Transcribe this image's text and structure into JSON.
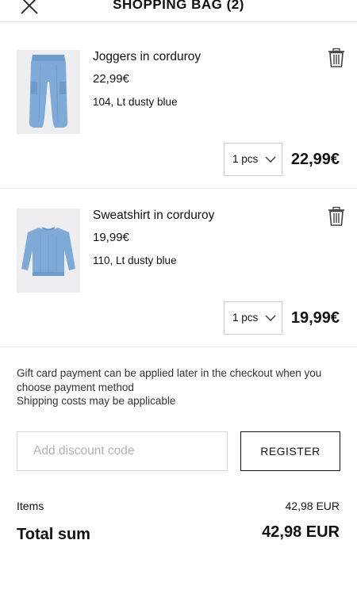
{
  "header": {
    "title": "SHOPPING BAG (2)",
    "close_icon": "close-icon"
  },
  "cart": {
    "items": [
      {
        "name": "Joggers in corduroy",
        "price": "22,99€",
        "variant": "104, Lt dusty blue",
        "quantity": "1 pcs",
        "line_total": "22,99€",
        "image": "corduroy-joggers-image",
        "color": "#7aa6d3"
      },
      {
        "name": "Sweatshirt in corduroy",
        "price": "19,99€",
        "variant": "110, Lt dusty blue",
        "quantity": "1 pcs",
        "line_total": "19,99€",
        "image": "corduroy-sweatshirt-image",
        "color": "#7aa6d3"
      }
    ]
  },
  "notes": {
    "gift_card": "Gift card payment can be applied later in the checkout when you choose payment method",
    "shipping": "Shipping costs may be applicable"
  },
  "discount": {
    "placeholder": "Add discount code",
    "register_label": "REGISTER"
  },
  "summary": {
    "items_label": "Items",
    "items_value": "42,98 EUR",
    "total_label": "Total sum",
    "total_value": "42,98 EUR"
  }
}
